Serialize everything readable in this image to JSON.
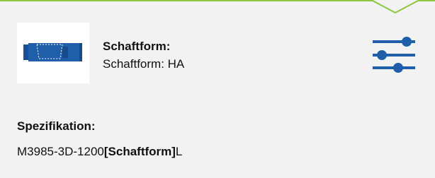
{
  "colors": {
    "accent_green": "#8cc63f",
    "brand_blue": "#1f5faa",
    "card_background": "#f2f2f2"
  },
  "shaft": {
    "thumbnail_icon": "shaft-tool-image",
    "label": "Schaftform:",
    "value": "Schaftform: HA"
  },
  "filter": {
    "icon": "sliders-icon"
  },
  "spec": {
    "label": "Spezifikation:",
    "value_prefix": "M3985-3D-1200",
    "value_highlight": "[Schaftform]",
    "value_suffix": "L"
  }
}
